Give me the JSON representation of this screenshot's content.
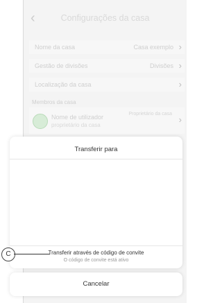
{
  "header": {
    "title": "Configurações da casa"
  },
  "settings": {
    "rows": [
      {
        "label": "Nome da casa",
        "value": "Casa exemplo"
      },
      {
        "label": "Gestão de divisões",
        "value": "Divisões"
      },
      {
        "label": "Localização da casa",
        "value": ""
      }
    ],
    "section_label": "Membros da casa",
    "member": {
      "name": "Nome de utilizador",
      "subtitle": "proprietário da casa",
      "badge": "Proprietário da casa"
    }
  },
  "sheet": {
    "title": "Transferir para",
    "invite_label": "Transferir através de código de convite",
    "invite_status": "O código de convite está ativo"
  },
  "cancel_label": "Cancelar",
  "callout": {
    "marker": "C"
  }
}
